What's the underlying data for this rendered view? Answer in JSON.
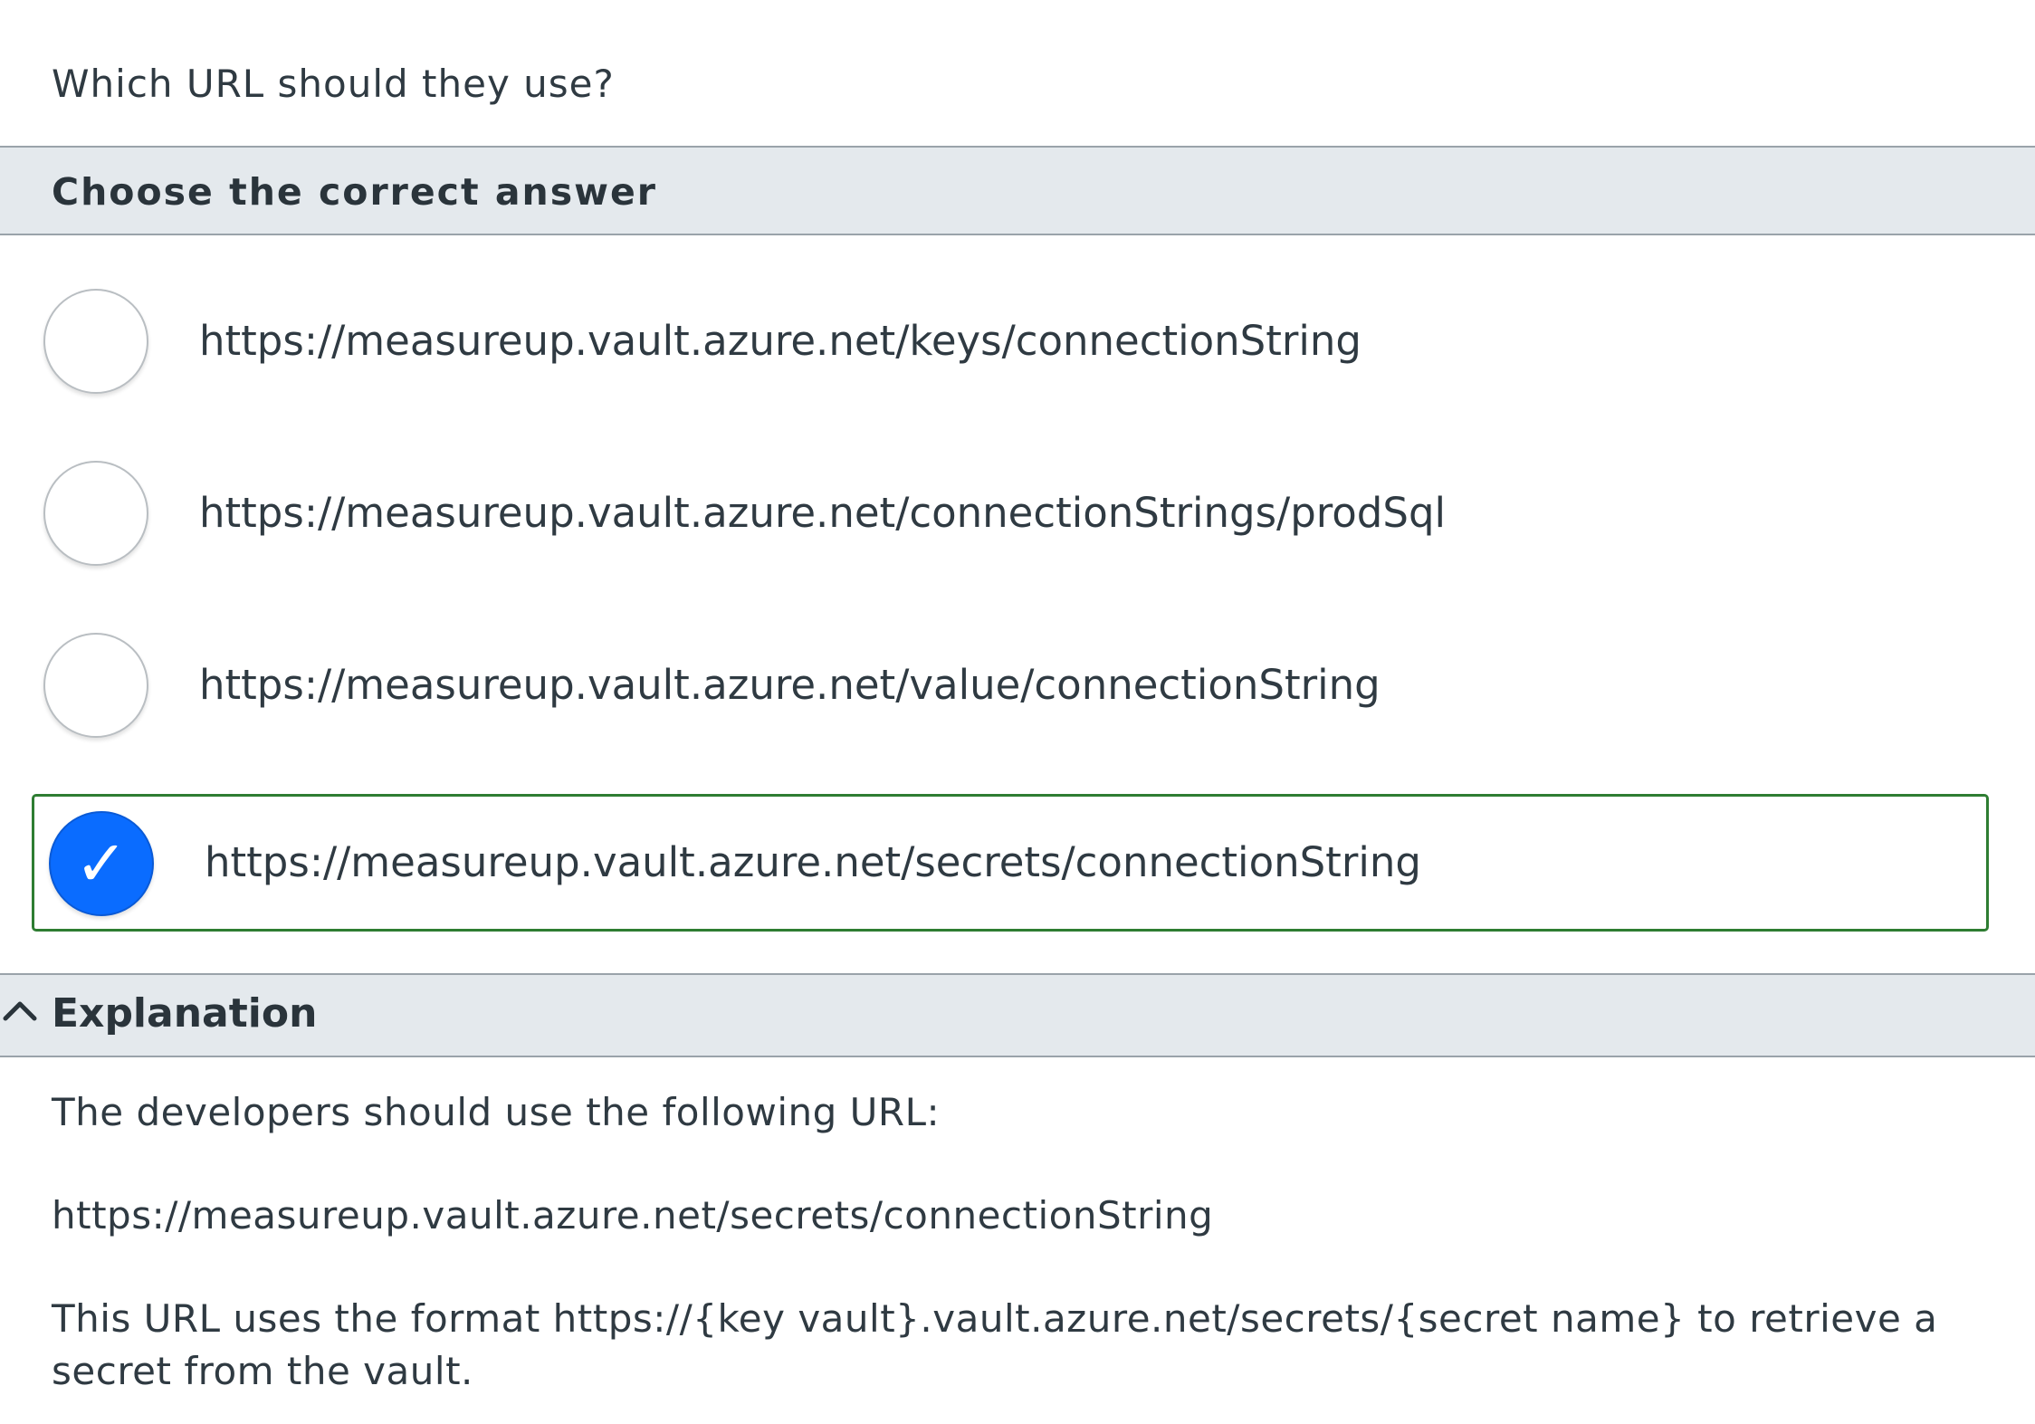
{
  "question": {
    "text": "Which URL should they use?"
  },
  "answer_header": {
    "label": "Choose the correct answer"
  },
  "options": [
    {
      "text": "https://measureup.vault.azure.net/keys/connectionString",
      "selected": false
    },
    {
      "text": "https://measureup.vault.azure.net/connectionStrings/prodSql",
      "selected": false
    },
    {
      "text": "https://measureup.vault.azure.net/value/connectionString",
      "selected": false
    },
    {
      "text": "https://measureup.vault.azure.net/secrets/connectionString",
      "selected": true
    }
  ],
  "explanation": {
    "label": "Explanation",
    "paragraphs": [
      "The developers should use the following URL:",
      "https://measureup.vault.azure.net/secrets/connectionString",
      "This URL uses the format https://{key vault}.vault.azure.net/secrets/{secret name} to retrieve a secret from the vault."
    ]
  },
  "colors": {
    "band_background": "#e4e9ed",
    "selected_border": "#2e7d32",
    "selected_radio": "#0a6cff",
    "text": "#2f3a42"
  },
  "icons": {
    "check": "check-icon",
    "chevron": "chevron-up-icon"
  }
}
